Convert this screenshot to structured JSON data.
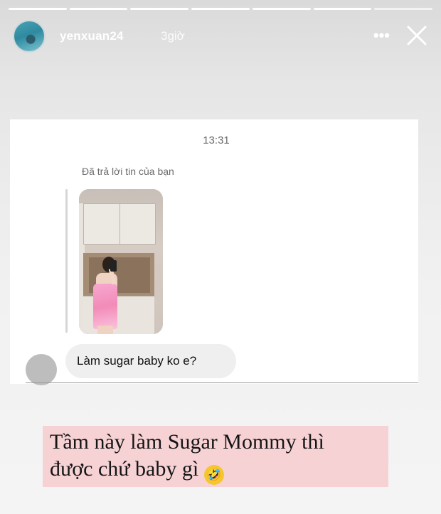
{
  "progress": {
    "segments": 7,
    "active_index": 6
  },
  "header": {
    "username": "yenxuan24",
    "time_ago": "3giờ",
    "more_icon": "more-icon",
    "close_icon": "close-icon"
  },
  "dm": {
    "timestamp": "13:31",
    "reply_label": "Đã trả lời tin của bạn",
    "message": "Làm sugar baby ko e?"
  },
  "caption": {
    "line1": "Tầm này làm Sugar Mommy thì",
    "line2": "được chứ baby gì",
    "emoji": "🤣"
  },
  "colors": {
    "caption_bg": "#f7d2d5",
    "bubble_bg": "#efefef"
  }
}
